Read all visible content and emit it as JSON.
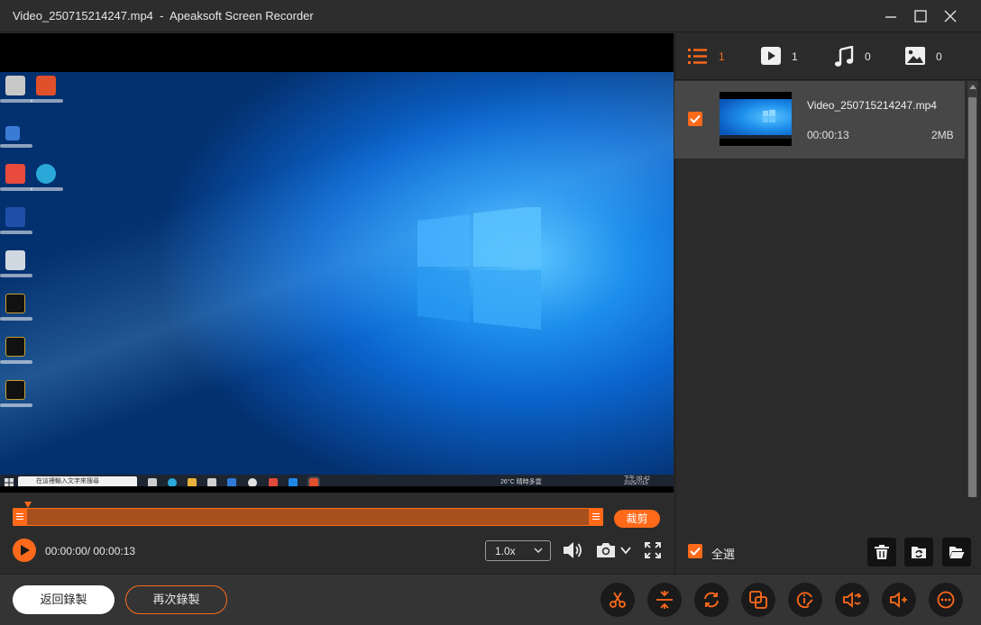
{
  "window": {
    "file_name": "Video_250715214247.mp4",
    "separator": "-",
    "app_name": "Apeaksoft Screen Recorder",
    "controls": [
      "minimize-icon",
      "maximize-icon",
      "close-icon"
    ]
  },
  "preview": {
    "taskbar_search": "在這裡輸入文字來搜尋",
    "tray_weather": "26°C 晴時多雲",
    "tray_time": "下午 09:42",
    "tray_date": "2025/7/15"
  },
  "timeline": {
    "trim_label": "裁剪",
    "time_display": "00:00:00/ 00:00:13",
    "speed": "1.0x"
  },
  "filters": [
    {
      "icon": "list-icon",
      "count": "1"
    },
    {
      "icon": "video-icon",
      "count": "1"
    },
    {
      "icon": "music-icon",
      "count": "0"
    },
    {
      "icon": "image-icon",
      "count": "0"
    }
  ],
  "files": [
    {
      "name": "Video_250715214247.mp4",
      "duration": "00:00:13",
      "size": "2MB",
      "checked": true
    }
  ],
  "side_footer": {
    "select_all": "全選",
    "actions": [
      "trash-icon",
      "convert-folder-icon",
      "open-folder-icon"
    ]
  },
  "bottom": {
    "back_label": "返回錄製",
    "rerecord_label": "再次錄製",
    "tools": [
      "scissors-icon",
      "merge-icon",
      "convert-icon",
      "compress-icon",
      "metadata-icon",
      "volume-boost-icon",
      "audio-add-icon",
      "more-icon"
    ]
  },
  "colors": {
    "accent": "#ff6a1a",
    "background": "#2b2b2b",
    "panel_selected": "#474747"
  }
}
